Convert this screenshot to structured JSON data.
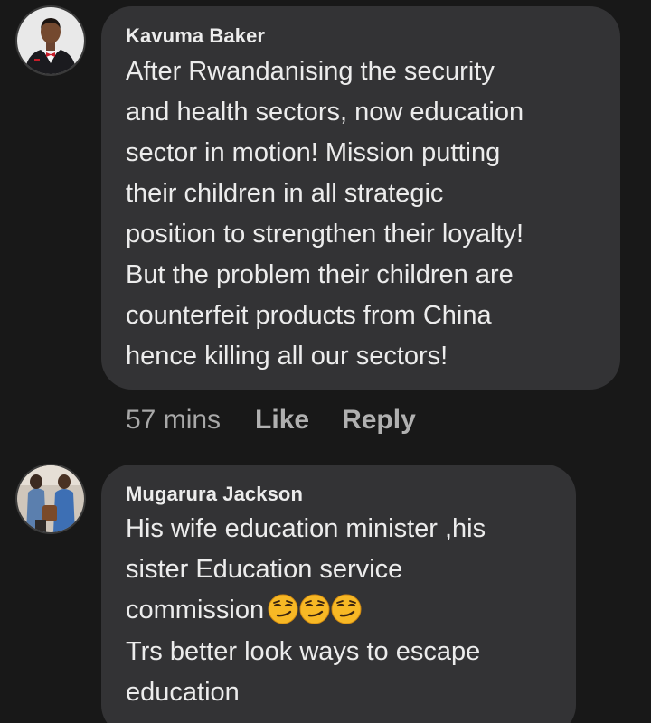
{
  "comments": [
    {
      "author": "Kavuma Baker",
      "avatar": "man-in-suit-photo",
      "lines": [
        "After Rwandanising the security",
        "and health sectors, now education",
        "sector in motion! Mission putting",
        "their children in all strategic",
        "position to strengthen their loyalty!",
        "But the problem their children are",
        "counterfeit products from China",
        "hence killing all our sectors!"
      ],
      "time": "57 mins",
      "like_label": "Like",
      "reply_label": "Reply"
    },
    {
      "author": "Mugarura Jackson",
      "avatar": "people-photo",
      "lines": [
        "His wife education minister ,his",
        "sister Education service",
        "commission",
        "Trs better look ways to escape",
        "education"
      ],
      "emoji": [
        "smirking-face-emoji",
        "smirking-face-emoji",
        "smirking-face-emoji"
      ]
    }
  ],
  "colors": {
    "background": "#181818",
    "bubble": "#333335",
    "text": "#ececec",
    "meta": "#a8a8a8"
  }
}
